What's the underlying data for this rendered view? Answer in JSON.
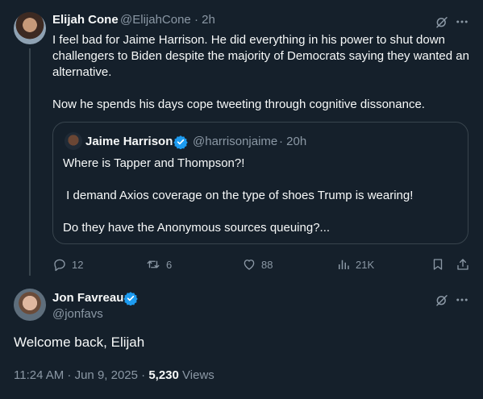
{
  "original_tweet": {
    "author_name": "Elijah Cone",
    "handle": "@ElijahCone",
    "time": "· 2h",
    "text": "I feel bad for Jaime Harrison. He did everything in his power to shut down challengers to Biden despite the majority of Democrats saying they wanted an alternative.\n\nNow he spends his days cope tweeting through cognitive dissonance.",
    "quoted": {
      "author_name": "Jaime Harrison",
      "handle": "@harrisonjaime",
      "time": "· 20h",
      "line1": "Where is Tapper and Thompson?!",
      "line2": " I demand Axios coverage on the type of shoes Trump is wearing!",
      "line3": "Do they have the Anonymous sources queuing?..."
    },
    "actions": {
      "replies": "12",
      "reposts": "6",
      "likes": "88",
      "views": "21K"
    }
  },
  "reply_tweet": {
    "author_name": "Jon Favreau",
    "handle": "@jonfavs",
    "text": "Welcome back, Elijah",
    "timestamp": "11:24 AM · Jun 9, 2025 · ",
    "views_count": "5,230",
    "views_label": " Views"
  },
  "colors": {
    "background": "#15202b",
    "text": "#f7f9f9",
    "secondary": "#8b98a5",
    "border": "#38444d",
    "verified": "#1d9bf0"
  },
  "icons": [
    "grok-icon",
    "more-icon",
    "verified-icon",
    "reply-icon",
    "repost-icon",
    "like-icon",
    "views-icon",
    "bookmark-icon",
    "share-icon"
  ]
}
